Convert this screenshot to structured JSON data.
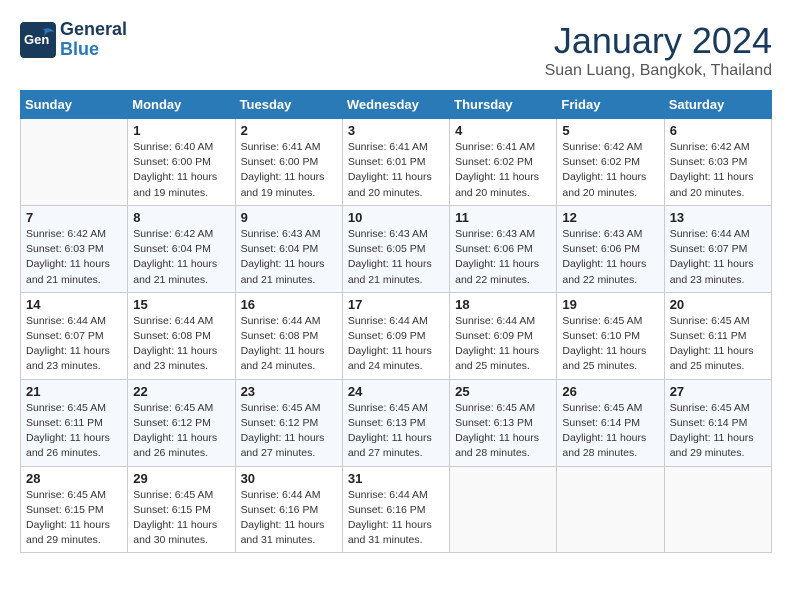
{
  "header": {
    "logo_line1": "General",
    "logo_line2": "Blue",
    "month": "January 2024",
    "location": "Suan Luang, Bangkok, Thailand"
  },
  "days_of_week": [
    "Sunday",
    "Monday",
    "Tuesday",
    "Wednesday",
    "Thursday",
    "Friday",
    "Saturday"
  ],
  "weeks": [
    [
      {
        "day": "",
        "info": ""
      },
      {
        "day": "1",
        "info": "Sunrise: 6:40 AM\nSunset: 6:00 PM\nDaylight: 11 hours\nand 19 minutes."
      },
      {
        "day": "2",
        "info": "Sunrise: 6:41 AM\nSunset: 6:00 PM\nDaylight: 11 hours\nand 19 minutes."
      },
      {
        "day": "3",
        "info": "Sunrise: 6:41 AM\nSunset: 6:01 PM\nDaylight: 11 hours\nand 20 minutes."
      },
      {
        "day": "4",
        "info": "Sunrise: 6:41 AM\nSunset: 6:02 PM\nDaylight: 11 hours\nand 20 minutes."
      },
      {
        "day": "5",
        "info": "Sunrise: 6:42 AM\nSunset: 6:02 PM\nDaylight: 11 hours\nand 20 minutes."
      },
      {
        "day": "6",
        "info": "Sunrise: 6:42 AM\nSunset: 6:03 PM\nDaylight: 11 hours\nand 20 minutes."
      }
    ],
    [
      {
        "day": "7",
        "info": "Sunrise: 6:42 AM\nSunset: 6:03 PM\nDaylight: 11 hours\nand 21 minutes."
      },
      {
        "day": "8",
        "info": "Sunrise: 6:42 AM\nSunset: 6:04 PM\nDaylight: 11 hours\nand 21 minutes."
      },
      {
        "day": "9",
        "info": "Sunrise: 6:43 AM\nSunset: 6:04 PM\nDaylight: 11 hours\nand 21 minutes."
      },
      {
        "day": "10",
        "info": "Sunrise: 6:43 AM\nSunset: 6:05 PM\nDaylight: 11 hours\nand 21 minutes."
      },
      {
        "day": "11",
        "info": "Sunrise: 6:43 AM\nSunset: 6:06 PM\nDaylight: 11 hours\nand 22 minutes."
      },
      {
        "day": "12",
        "info": "Sunrise: 6:43 AM\nSunset: 6:06 PM\nDaylight: 11 hours\nand 22 minutes."
      },
      {
        "day": "13",
        "info": "Sunrise: 6:44 AM\nSunset: 6:07 PM\nDaylight: 11 hours\nand 23 minutes."
      }
    ],
    [
      {
        "day": "14",
        "info": "Sunrise: 6:44 AM\nSunset: 6:07 PM\nDaylight: 11 hours\nand 23 minutes."
      },
      {
        "day": "15",
        "info": "Sunrise: 6:44 AM\nSunset: 6:08 PM\nDaylight: 11 hours\nand 23 minutes."
      },
      {
        "day": "16",
        "info": "Sunrise: 6:44 AM\nSunset: 6:08 PM\nDaylight: 11 hours\nand 24 minutes."
      },
      {
        "day": "17",
        "info": "Sunrise: 6:44 AM\nSunset: 6:09 PM\nDaylight: 11 hours\nand 24 minutes."
      },
      {
        "day": "18",
        "info": "Sunrise: 6:44 AM\nSunset: 6:09 PM\nDaylight: 11 hours\nand 25 minutes."
      },
      {
        "day": "19",
        "info": "Sunrise: 6:45 AM\nSunset: 6:10 PM\nDaylight: 11 hours\nand 25 minutes."
      },
      {
        "day": "20",
        "info": "Sunrise: 6:45 AM\nSunset: 6:11 PM\nDaylight: 11 hours\nand 25 minutes."
      }
    ],
    [
      {
        "day": "21",
        "info": "Sunrise: 6:45 AM\nSunset: 6:11 PM\nDaylight: 11 hours\nand 26 minutes."
      },
      {
        "day": "22",
        "info": "Sunrise: 6:45 AM\nSunset: 6:12 PM\nDaylight: 11 hours\nand 26 minutes."
      },
      {
        "day": "23",
        "info": "Sunrise: 6:45 AM\nSunset: 6:12 PM\nDaylight: 11 hours\nand 27 minutes."
      },
      {
        "day": "24",
        "info": "Sunrise: 6:45 AM\nSunset: 6:13 PM\nDaylight: 11 hours\nand 27 minutes."
      },
      {
        "day": "25",
        "info": "Sunrise: 6:45 AM\nSunset: 6:13 PM\nDaylight: 11 hours\nand 28 minutes."
      },
      {
        "day": "26",
        "info": "Sunrise: 6:45 AM\nSunset: 6:14 PM\nDaylight: 11 hours\nand 28 minutes."
      },
      {
        "day": "27",
        "info": "Sunrise: 6:45 AM\nSunset: 6:14 PM\nDaylight: 11 hours\nand 29 minutes."
      }
    ],
    [
      {
        "day": "28",
        "info": "Sunrise: 6:45 AM\nSunset: 6:15 PM\nDaylight: 11 hours\nand 29 minutes."
      },
      {
        "day": "29",
        "info": "Sunrise: 6:45 AM\nSunset: 6:15 PM\nDaylight: 11 hours\nand 30 minutes."
      },
      {
        "day": "30",
        "info": "Sunrise: 6:44 AM\nSunset: 6:16 PM\nDaylight: 11 hours\nand 31 minutes."
      },
      {
        "day": "31",
        "info": "Sunrise: 6:44 AM\nSunset: 6:16 PM\nDaylight: 11 hours\nand 31 minutes."
      },
      {
        "day": "",
        "info": ""
      },
      {
        "day": "",
        "info": ""
      },
      {
        "day": "",
        "info": ""
      }
    ]
  ]
}
